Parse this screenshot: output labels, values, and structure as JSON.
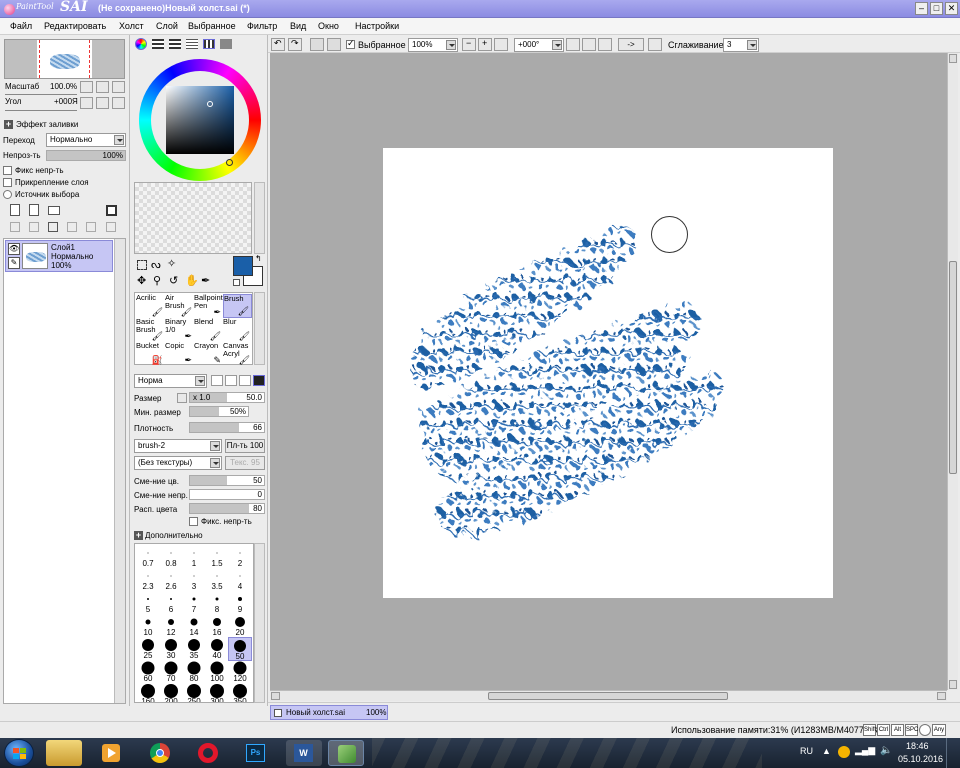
{
  "window": {
    "app_name_small": "PaintTool",
    "app_name_big": "SAI",
    "title": "(Не сохранено)Новый холст.sai (*)"
  },
  "menu": [
    "Файл",
    "Редактировать",
    "Холст",
    "Слой",
    "Выбранное",
    "Фильтр",
    "Вид",
    "Окно",
    "Настройки"
  ],
  "navigator": {
    "zoom_label": "Масштаб",
    "zoom_value": "100.0%",
    "angle_label": "Угол",
    "angle_value": "+000Я"
  },
  "layer_panel": {
    "fill_effect": "Эффект заливки",
    "blend_label": "Переход",
    "blend_value": "Нормально",
    "opacity_label": "Непроз-ть",
    "opacity_value": "100%",
    "opacity_fraction": 1.0,
    "chk_lock_opacity": "Фикс непр-ть",
    "chk_clip": "Прикрепление слоя",
    "radio_source": "Источник выбора",
    "layer": {
      "name": "Слой1",
      "mode": "Нормально",
      "opacity": "100%"
    }
  },
  "toolbar": {
    "selection_label": "Выбранное",
    "zoom": "100%",
    "angle": "+000°",
    "arrow": "->",
    "smoothing_label": "Сглаживание",
    "smoothing_value": "3"
  },
  "tools": [
    {
      "name": "Acrilic",
      "selected": false
    },
    {
      "name": "Air Brush",
      "selected": false
    },
    {
      "name": "Ballpoint Pen",
      "selected": false
    },
    {
      "name": "Brush",
      "selected": true
    },
    {
      "name": "Basic Brush",
      "selected": false
    },
    {
      "name": "Binary 1/0",
      "selected": false
    },
    {
      "name": "Blend",
      "selected": false
    },
    {
      "name": "Blur",
      "selected": false
    },
    {
      "name": "Bucket",
      "selected": false
    },
    {
      "name": "Copic",
      "selected": false
    },
    {
      "name": "Crayon",
      "selected": false
    },
    {
      "name": "Canvas Acryl",
      "selected": false
    }
  ],
  "brush": {
    "mode": "Норма",
    "size_label": "Размер",
    "size_mult": "x 1.0",
    "size_value": "50.0",
    "size_fraction": 0.5,
    "min_size_label": "Мин. размер",
    "min_size_value": "50%",
    "min_size_fraction": 0.5,
    "density_label": "Плотность",
    "density_value": "66",
    "density_fraction": 0.66,
    "shape": "brush-2",
    "shape_strength": "Пл-ть 100",
    "texture": "(Без текстуры)",
    "texture_strength": "Текс. 95",
    "color_mix_label": "Сме-ние цв.",
    "color_mix_value": "50",
    "color_mix_fraction": 0.5,
    "opacity_mix_label": "Сме-ние непр.",
    "opacity_mix_value": "0",
    "opacity_mix_fraction": 0.0,
    "color_spread_label": "Расп. цвета",
    "color_spread_value": "80",
    "color_spread_fraction": 0.8,
    "fix_opacity_label": "Фикс. непр-ть",
    "advanced_label": "Дополнительно"
  },
  "brush_sizes": [
    "0.7",
    "0.8",
    "1",
    "1.5",
    "2",
    "2.3",
    "2.6",
    "3",
    "3.5",
    "4",
    "5",
    "6",
    "7",
    "8",
    "9",
    "10",
    "12",
    "14",
    "16",
    "20",
    "25",
    "30",
    "35",
    "40",
    "50",
    "60",
    "70",
    "80",
    "100",
    "120",
    "160",
    "200",
    "250",
    "300",
    "350"
  ],
  "selected_brush_size": "50",
  "colors": {
    "primary": "#1a5fa8",
    "accent_title": "#9b9be8",
    "selection": "#c6c6f4"
  },
  "doc_tab": {
    "name": "Новый холст.sai",
    "zoom": "100%"
  },
  "status": {
    "memory": "Использование памяти:31% (И1283MB/M4077MB)",
    "keys": [
      "Shift",
      "Ctrl",
      "Alt",
      "SPC",
      "Any"
    ]
  },
  "taskbar": {
    "lang": "RU",
    "time": "18:46",
    "date": "05.10.2016"
  }
}
